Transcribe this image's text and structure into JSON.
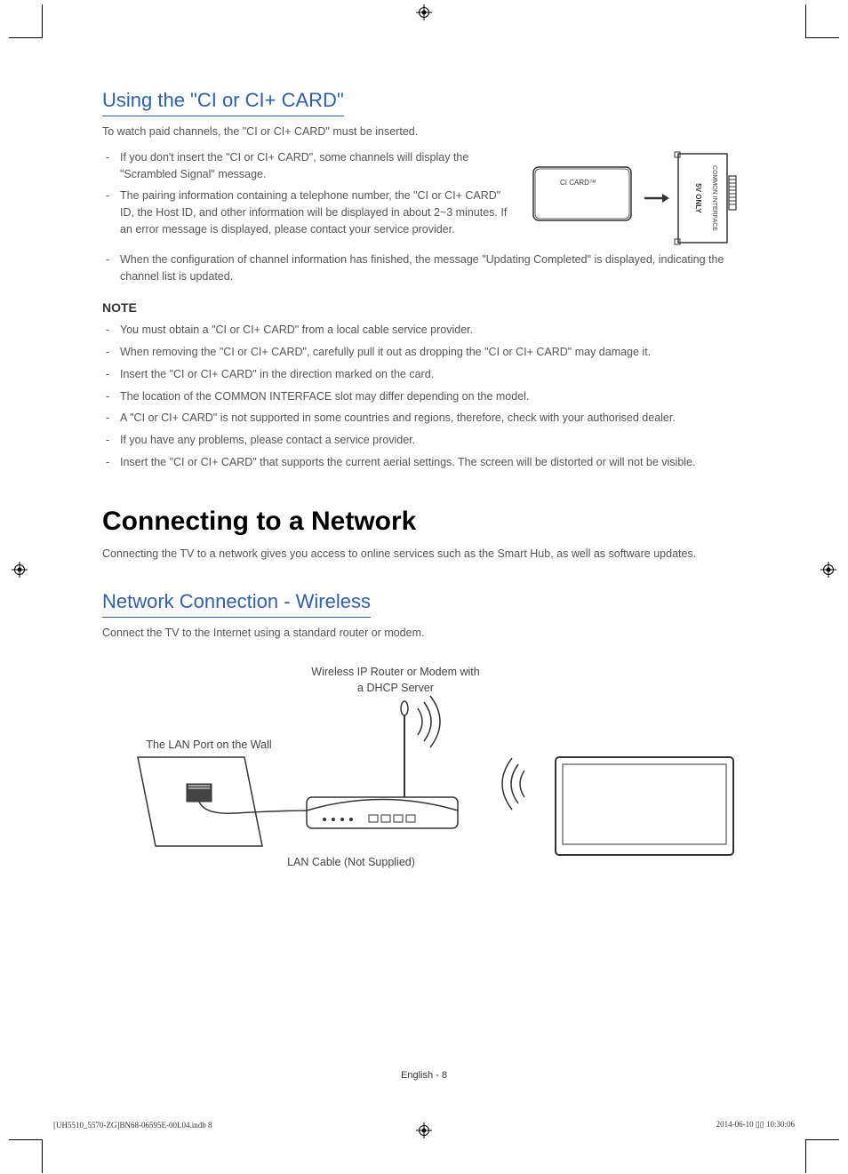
{
  "section_ci": {
    "title": "Using the \"CI or CI+ CARD\"",
    "intro": "To watch paid channels, the \"CI or CI+ CARD\" must be inserted.",
    "bullets_top": [
      "If you don't insert the \"CI or CI+ CARD\", some channels will display the \"Scrambled Signal\" message.",
      "The pairing information containing a telephone number, the \"CI or CI+ CARD\" ID, the Host ID, and other information will be displayed in about 2~3 minutes. If an error message is displayed, please contact your service provider.",
      "When the configuration of channel information has finished, the message \"Updating Completed\" is displayed, indicating the channel list is updated."
    ],
    "note_heading": "NOTE",
    "note_bullets": [
      "You must obtain a \"CI or CI+ CARD\" from a local cable service provider.",
      "When removing the \"CI or CI+ CARD\", carefully pull it out as dropping the \"CI or CI+ CARD\" may damage it.",
      "Insert the \"CI or CI+ CARD\" in the direction marked on the card.",
      "The location of the COMMON INTERFACE slot may differ depending on the model.",
      "A \"CI or CI+ CARD\" is not supported in some countries and regions, therefore, check with your authorised dealer.",
      "If you have any problems, please contact a service provider.",
      "Insert the \"CI or CI+ CARD\" that supports the current aerial settings. The screen will be distorted or will not be visible."
    ],
    "figure": {
      "card_label": "CI CARD™",
      "slot_label_1": "COMMON INTERFACE",
      "slot_label_2": "5V ONLY"
    }
  },
  "section_net": {
    "title": "Connecting to a Network",
    "intro": "Connecting the TV to a network gives you access to online services such as the Smart Hub, as well as software updates."
  },
  "section_wireless": {
    "title": "Network Connection - Wireless",
    "intro": "Connect the TV to the Internet using a standard router or modem.",
    "diagram": {
      "router_label": "Wireless IP Router or Modem with a DHCP Server",
      "wall_label": "The LAN Port on the Wall",
      "cable_label": "LAN Cable (Not Supplied)"
    }
  },
  "footer": {
    "page_label": "English - 8",
    "doc_id": "[UH5510_5570-ZG]BN68-06595E-00L04.indb   8",
    "timestamp": "2014-06-10   ▯▯ 10:30:06"
  }
}
